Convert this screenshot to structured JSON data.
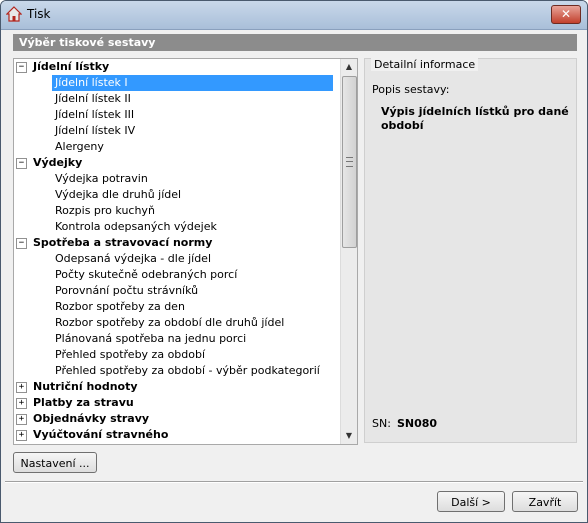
{
  "window": {
    "title": "Tisk",
    "close_glyph": "✕"
  },
  "header": {
    "title": "Výběr tiskové sestavy"
  },
  "tree": {
    "rows": [
      {
        "kind": "group",
        "expander": "−",
        "label": "Jídelní lístky"
      },
      {
        "kind": "item",
        "label": "Jídelní lístek I",
        "selected": true
      },
      {
        "kind": "item",
        "label": "Jídelní lístek II"
      },
      {
        "kind": "item",
        "label": "Jídelní lístek III"
      },
      {
        "kind": "item",
        "label": "Jídelní lístek IV"
      },
      {
        "kind": "item",
        "label": "Alergeny"
      },
      {
        "kind": "group",
        "expander": "−",
        "label": "Výdejky"
      },
      {
        "kind": "item",
        "label": "Výdejka potravin"
      },
      {
        "kind": "item",
        "label": "Výdejka dle druhů jídel"
      },
      {
        "kind": "item",
        "label": "Rozpis pro kuchyň"
      },
      {
        "kind": "item",
        "label": "Kontrola odepsaných výdejek"
      },
      {
        "kind": "group",
        "expander": "−",
        "label": "Spotřeba a stravovací normy"
      },
      {
        "kind": "item",
        "label": "Odepsaná výdejka - dle jídel"
      },
      {
        "kind": "item",
        "label": "Počty skutečně odebraných porcí"
      },
      {
        "kind": "item",
        "label": "Porovnání počtu strávníků"
      },
      {
        "kind": "item",
        "label": "Rozbor spotřeby za den"
      },
      {
        "kind": "item",
        "label": "Rozbor spotřeby za období dle druhů jídel"
      },
      {
        "kind": "item",
        "label": "Plánovaná spotřeba na jednu porci"
      },
      {
        "kind": "item",
        "label": "Přehled spotřeby za období"
      },
      {
        "kind": "item",
        "label": "Přehled spotřeby za období - výběr podkategorií"
      },
      {
        "kind": "group",
        "expander": "+",
        "label": "Nutriční hodnoty"
      },
      {
        "kind": "group",
        "expander": "+",
        "label": "Platby za stravu"
      },
      {
        "kind": "group",
        "expander": "+",
        "label": "Objednávky stravy"
      },
      {
        "kind": "group",
        "expander": "+",
        "label": "Vyúčtování stravného"
      }
    ]
  },
  "scrollbar": {
    "up_glyph": "▲",
    "down_glyph": "▼"
  },
  "info": {
    "legend": "Detailní informace",
    "label": "Popis sestavy:",
    "description": "Výpis jídelních lístků pro dané období",
    "sn_label": "SN:",
    "sn_value": "SN080"
  },
  "buttons": {
    "settings": "Nastavení ...",
    "next": "Další >",
    "close": "Zavřít"
  }
}
